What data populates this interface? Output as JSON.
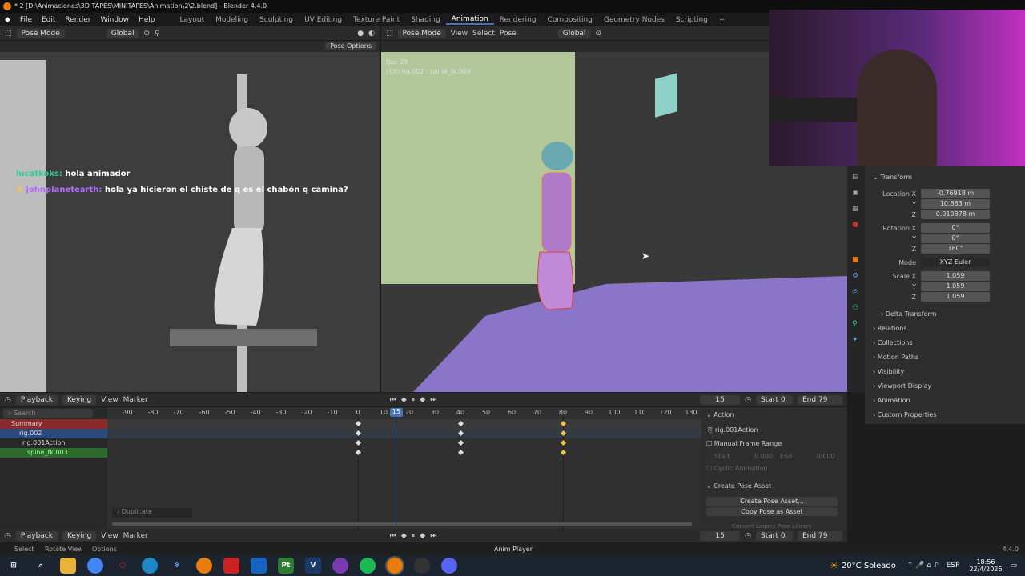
{
  "titlebar": {
    "title": "* 2 [D:\\Animaciones\\3D TAPES\\MINITAPES\\Animation\\2\\2.blend] - Blender 4.4.0"
  },
  "menu": [
    "File",
    "Edit",
    "Render",
    "Window",
    "Help"
  ],
  "workspaces": [
    "Layout",
    "Modeling",
    "Sculpting",
    "UV Editing",
    "Texture Paint",
    "Shading",
    "Animation",
    "Rendering",
    "Compositing",
    "Geometry Nodes",
    "Scripting"
  ],
  "active_workspace": "Animation",
  "left_vp": {
    "mode": "Pose Mode",
    "orientation": "Global",
    "pose_options": "Pose Options"
  },
  "right_vp": {
    "mode": "Pose Mode",
    "menu": [
      "View",
      "Select",
      "Pose"
    ],
    "orientation": "Global",
    "fps": "fps: 24",
    "info": "(15) rig.002 : spine_fk.003"
  },
  "chat": [
    {
      "user": "lucatkoks:",
      "msg": "hola animador",
      "color": "#33cc99"
    },
    {
      "user": "johnplanetearth:",
      "msg": "hola ya hicieron el chiste de q es el chabón q camina?",
      "color": "#b36bff"
    }
  ],
  "properties": {
    "transform": "Transform",
    "location_label": "Location X",
    "loc": [
      "-0.76918 m",
      "10.863 m",
      "0.010878 m"
    ],
    "rotation_label": "Rotation X",
    "rot": [
      "0°",
      "0°",
      "180°"
    ],
    "mode_label": "Mode",
    "mode": "XYZ Euler",
    "scale_label": "Scale X",
    "scale": [
      "1.059",
      "1.059",
      "1.059"
    ],
    "y": "Y",
    "z": "Z",
    "sections": [
      "Delta Transform",
      "Relations",
      "Collections",
      "Motion Paths",
      "Visibility",
      "Viewport Display",
      "Animation",
      "Custom Properties"
    ]
  },
  "timeline_hdr": {
    "menu": [
      "Playback",
      "Keying",
      "View",
      "Marker"
    ],
    "frame": "15",
    "start_label": "Start",
    "start": "0",
    "end_label": "End",
    "end": "79"
  },
  "dopesheet": {
    "search": "Search",
    "rows": [
      "Summary",
      "rig.002",
      "rig.001Action",
      "spine_fk.003"
    ],
    "ticks": [
      "-90",
      "-80",
      "-70",
      "-60",
      "-50",
      "-40",
      "-30",
      "-20",
      "-10",
      "0",
      "10",
      "20",
      "30",
      "40",
      "50",
      "60",
      "70",
      "80",
      "90",
      "100",
      "110",
      "120",
      "130"
    ],
    "current": "15",
    "duplicate": "Duplicate"
  },
  "action_panel": {
    "title": "Action",
    "action": "rig.001Action",
    "manual": "Manual Frame Range",
    "start": "Start",
    "start_val": "0.000",
    "end": "End",
    "end_val": "0.000",
    "cyclic": "Cyclic Animation",
    "pose_title": "Create Pose Asset",
    "create": "Create Pose Asset...",
    "copy": "Copy Pose as Asset",
    "convert": "Convert Legacy Pose Library"
  },
  "bottom_timeline": {
    "menu": [
      "Playback",
      "Keying",
      "View",
      "Marker"
    ],
    "frame": "15",
    "start_label": "Start",
    "start": "0",
    "end_label": "End",
    "end": "79"
  },
  "statusbar": {
    "select": "Select",
    "rotate": "Rotate View",
    "options": "Options",
    "anim": "Anim Player",
    "version": "4.4.0"
  },
  "taskbar": {
    "weather": "20°C Soleado",
    "lang": "ESP",
    "time": "18:56",
    "date": "22/4/2026"
  },
  "colors": {
    "accent": "#4772b3",
    "summary": "#8b2a2a",
    "rig": "#2a4a7a",
    "channel": "#2d6b2d",
    "key": "#dddddd",
    "key_sel": "#f0c040"
  }
}
